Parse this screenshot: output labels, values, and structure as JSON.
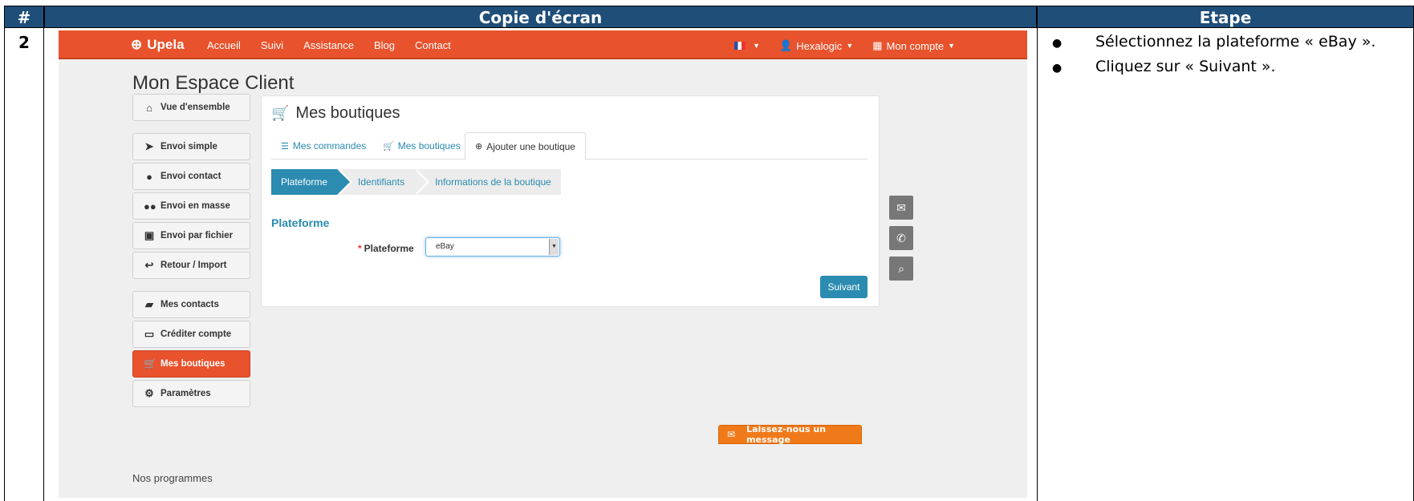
{
  "table": {
    "header_num": "#",
    "header_screenshot": "Copie d'écran",
    "header_step": "Etape",
    "row_num": "2",
    "steps": [
      "Sélectionnez la plateforme « eBay ».",
      "Cliquez sur « Suivant »."
    ]
  },
  "navbar": {
    "brand": "Upela",
    "links": [
      "Accueil",
      "Suivi",
      "Assistance",
      "Blog",
      "Contact"
    ],
    "user": "Hexalogic",
    "account": "Mon compte",
    "color": "#e8522c"
  },
  "page_title": "Mon Espace Client",
  "sidebar": {
    "items": [
      {
        "label": "Vue d'ensemble",
        "icon": "home-icon"
      },
      {
        "label": "Envoi simple",
        "icon": "paper-plane-icon"
      },
      {
        "label": "Envoi contact",
        "icon": "user-icon"
      },
      {
        "label": "Envoi en masse",
        "icon": "users-icon"
      },
      {
        "label": "Envoi par fichier",
        "icon": "floppy-icon"
      },
      {
        "label": "Retour / Import",
        "icon": "reply-icon"
      },
      {
        "label": "Mes contacts",
        "icon": "book-icon"
      },
      {
        "label": "Créditer compte",
        "icon": "credit-card-icon"
      },
      {
        "label": "Mes boutiques",
        "icon": "cart-icon",
        "active": true
      },
      {
        "label": "Paramètres",
        "icon": "gears-icon"
      }
    ],
    "programs": "Nos programmes"
  },
  "panel": {
    "title": "Mes boutiques",
    "tabs": [
      "Mes commandes",
      "Mes boutiques",
      "Ajouter une boutique"
    ],
    "active_tab": "Ajouter une boutique",
    "wizard": [
      "Plateforme",
      "Identifiants",
      "Informations de la boutique"
    ],
    "section_title": "Plateforme",
    "field_label": "Plateforme",
    "required_mark": "*",
    "select_value": "eBay",
    "next_button": "Suivant",
    "accent": "#2b8bb0"
  },
  "floating": [
    "envelope-icon",
    "phone-icon",
    "search-icon"
  ],
  "message_button": "Laissez-nous un message"
}
